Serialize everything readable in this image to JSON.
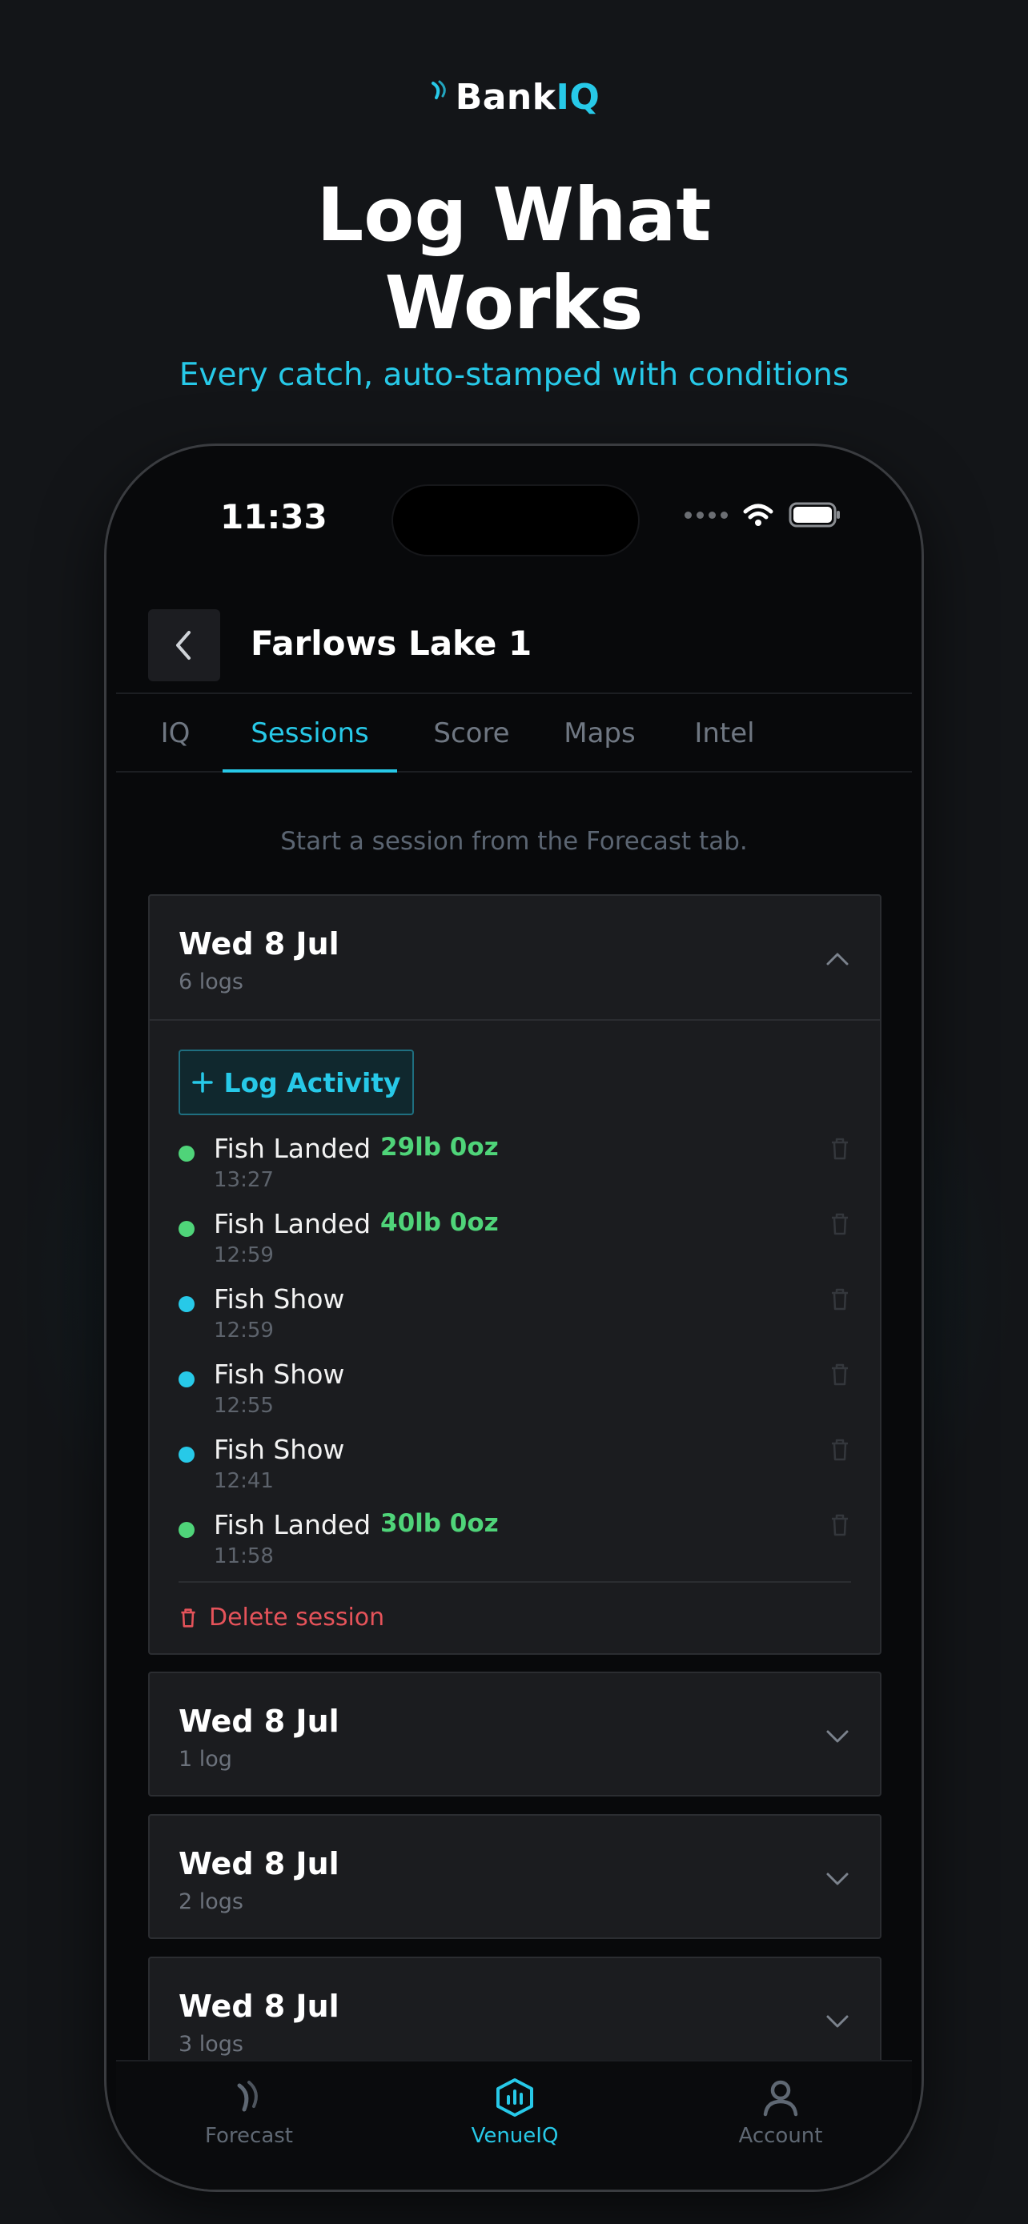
{
  "brand": {
    "part1": "Bank",
    "part2": "IQ"
  },
  "hero": {
    "title": "Log What\nWorks",
    "subtitle": "Every catch, auto-stamped with conditions"
  },
  "status_bar": {
    "time": "11:33"
  },
  "nav": {
    "title": "Farlows Lake 1"
  },
  "tabs": [
    {
      "label": "IQ",
      "active": false
    },
    {
      "label": "Sessions",
      "active": true
    },
    {
      "label": "Score",
      "active": false
    },
    {
      "label": "Maps",
      "active": false
    },
    {
      "label": "Intel",
      "active": false
    }
  ],
  "hint": "Start a session from the Forecast tab.",
  "sessions": [
    {
      "date": "Wed 8 Jul",
      "count": "6 logs",
      "expanded": true,
      "log_button": "Log Activity",
      "logs": [
        {
          "type": "Fish Landed",
          "weight": "29lb 0oz",
          "time": "13:27",
          "color": "#4fd479"
        },
        {
          "type": "Fish Landed",
          "weight": "40lb 0oz",
          "time": "12:59",
          "color": "#4fd479"
        },
        {
          "type": "Fish Show",
          "weight": "",
          "time": "12:59",
          "color": "#27c9e8"
        },
        {
          "type": "Fish Show",
          "weight": "",
          "time": "12:55",
          "color": "#27c9e8"
        },
        {
          "type": "Fish Show",
          "weight": "",
          "time": "12:41",
          "color": "#27c9e8"
        },
        {
          "type": "Fish Landed",
          "weight": "30lb 0oz",
          "time": "11:58",
          "color": "#4fd479"
        }
      ],
      "delete_label": "Delete session"
    },
    {
      "date": "Wed 8 Jul",
      "count": "1 log",
      "expanded": false
    },
    {
      "date": "Wed 8 Jul",
      "count": "2 logs",
      "expanded": false
    },
    {
      "date": "Wed 8 Jul",
      "count": "3 logs",
      "expanded": false
    }
  ],
  "tabbar": [
    {
      "label": "Forecast",
      "icon": "forecast-icon",
      "active": false
    },
    {
      "label": "VenueIQ",
      "icon": "venueiq-icon",
      "active": true
    },
    {
      "label": "Account",
      "icon": "account-icon",
      "active": false
    }
  ],
  "colors": {
    "accent": "#27c9e8",
    "landed": "#4fd479",
    "show": "#27c9e8",
    "danger": "#e5535a"
  }
}
